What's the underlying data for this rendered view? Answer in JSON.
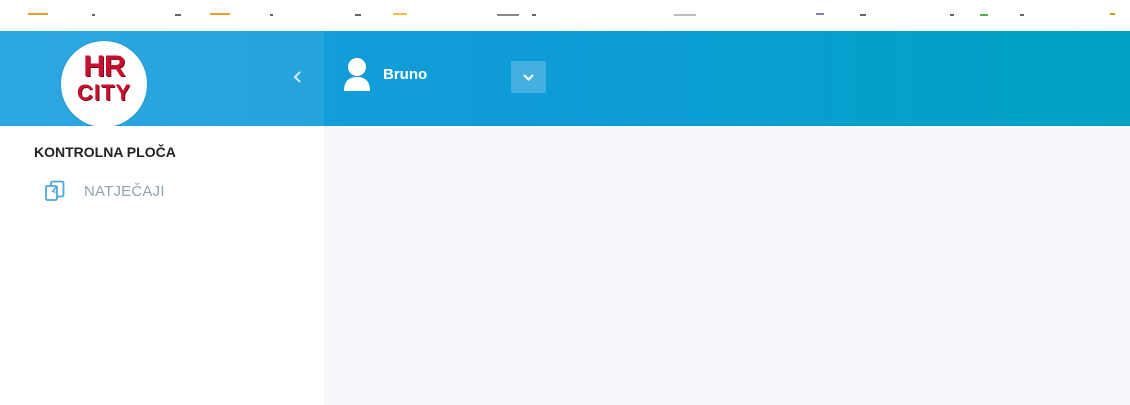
{
  "header": {
    "logo": {
      "line1": "HR",
      "line2": "CITY"
    },
    "collapse_icon": "chevron-left-icon",
    "user": {
      "name": "Bruno",
      "icon": "user-icon",
      "dropdown_icon": "chevron-down-icon"
    },
    "colors": {
      "gradient_start": "#1aa0e0",
      "gradient_end": "#00a2c4",
      "logo_red": "#c8102e"
    }
  },
  "sidebar": {
    "section_title": "KONTROLNA PLOČA",
    "items": [
      {
        "label": "NATJEČAJI",
        "icon": "documents-icon"
      }
    ]
  }
}
